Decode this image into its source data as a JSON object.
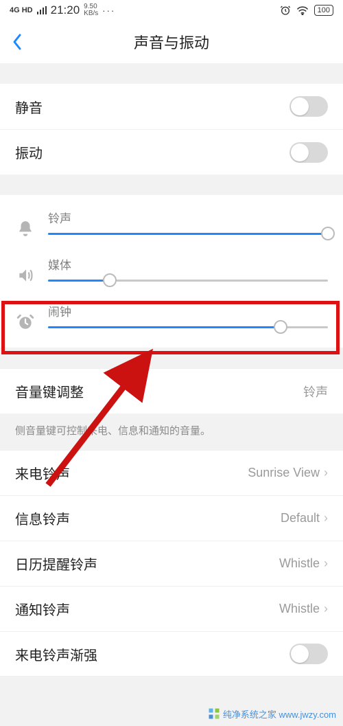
{
  "status": {
    "network": "4G HD",
    "time": "21:20",
    "kbps_top": "9.50",
    "kbps_bot": "KB/s",
    "dots": "···",
    "battery": "100"
  },
  "header": {
    "title": "声音与振动"
  },
  "toggles": {
    "silent": "静音",
    "vibrate": "振动",
    "fadein": "来电铃声渐强"
  },
  "sliders": {
    "ring": {
      "label": "铃声",
      "percent": 100
    },
    "media": {
      "label": "媒体",
      "percent": 22
    },
    "alarm": {
      "label": "闹钟",
      "percent": 83
    }
  },
  "volkey": {
    "label": "音量键调整",
    "value": "铃声"
  },
  "desc": "侧音量键可控制来电、信息和通知的音量。",
  "ringtones": {
    "incoming": {
      "label": "来电铃声",
      "value": "Sunrise View"
    },
    "message": {
      "label": "信息铃声",
      "value": "Default"
    },
    "calendar": {
      "label": "日历提醒铃声",
      "value": "Whistle"
    },
    "notify": {
      "label": "通知铃声",
      "value": "Whistle"
    }
  },
  "watermark": "纯净系统之家 www.jwzy.com"
}
